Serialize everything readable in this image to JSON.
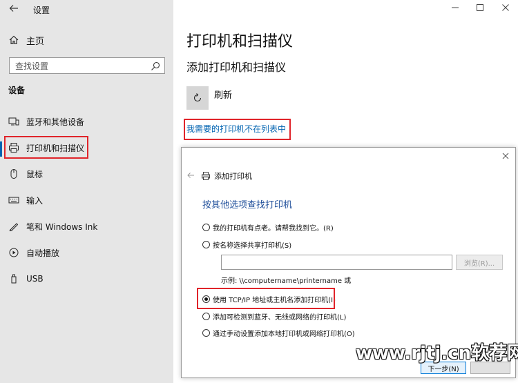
{
  "window": {
    "title": "设置"
  },
  "sidebar": {
    "home_label": "主页",
    "search_placeholder": "查找设置",
    "section_heading": "设备",
    "items": [
      {
        "label": "蓝牙和其他设备",
        "icon": "bluetooth-devices-icon"
      },
      {
        "label": "打印机和扫描仪",
        "icon": "printer-icon",
        "selected": true
      },
      {
        "label": "鼠标",
        "icon": "mouse-icon"
      },
      {
        "label": "输入",
        "icon": "keyboard-icon"
      },
      {
        "label": "笔和 Windows Ink",
        "icon": "pen-icon"
      },
      {
        "label": "自动播放",
        "icon": "autoplay-icon"
      },
      {
        "label": "USB",
        "icon": "usb-icon"
      }
    ]
  },
  "main": {
    "title": "打印机和扫描仪",
    "subtitle": "添加打印机和扫描仪",
    "refresh_label": "刷新",
    "missing_printer_link": "我需要的打印机不在列表中"
  },
  "dialog": {
    "title": "添加打印机",
    "heading": "按其他选项查找打印机",
    "options": [
      {
        "label": "我的打印机有点老。请帮我找到它。(R)",
        "selected": false
      },
      {
        "label": "按名称选择共享打印机(S)",
        "selected": false
      },
      {
        "label": "使用 TCP/IP 地址或主机名添加打印机(I)",
        "selected": true
      },
      {
        "label": "添加可检测到蓝牙、无线或网络的打印机(L)",
        "selected": false
      },
      {
        "label": "通过手动设置添加本地打印机或网络打印机(O)",
        "selected": false
      }
    ],
    "name_input_value": "",
    "browse_label": "浏览(R)...",
    "example_text": "示例: \\\\computername\\printername 或",
    "next_label": "下一步(N)"
  },
  "watermark": "www.rjtj.cn软荐网",
  "colors": {
    "accent": "#0063b1",
    "highlight_box": "#e0242a",
    "link": "#0063b1"
  }
}
